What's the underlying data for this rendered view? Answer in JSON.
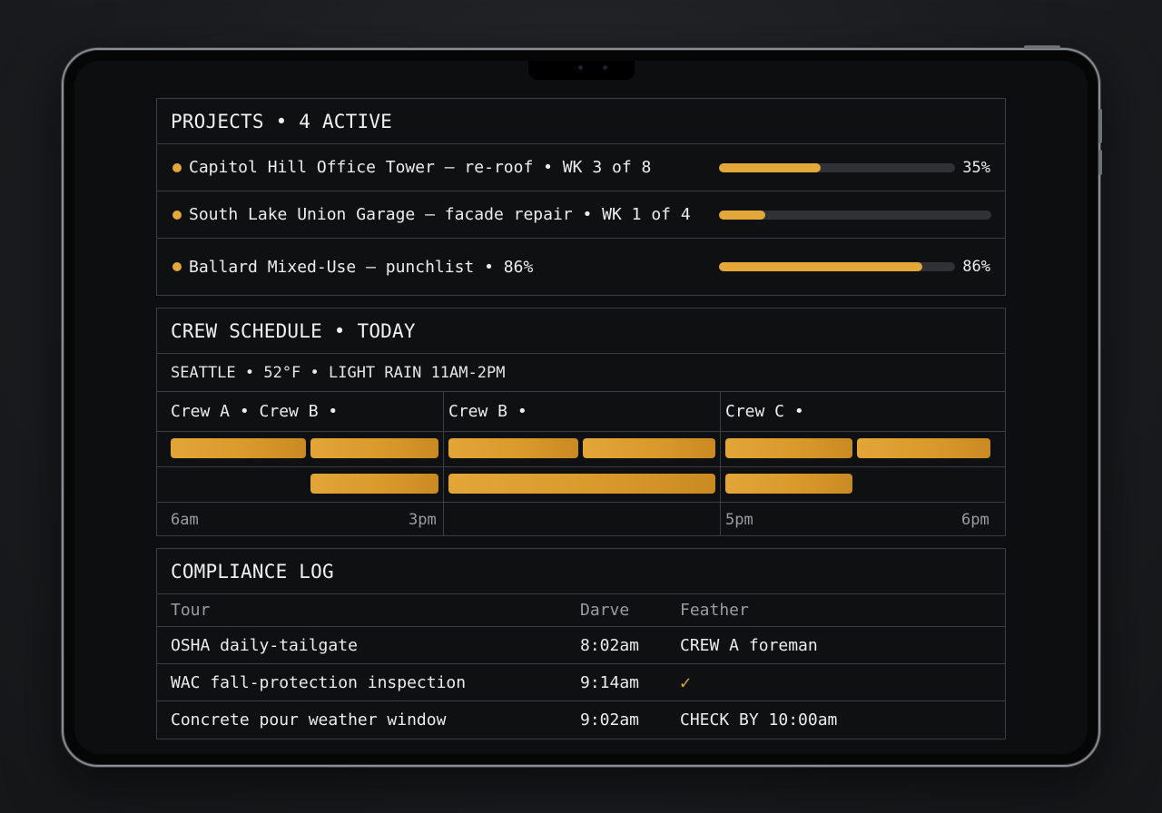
{
  "projects": {
    "title": "PROJECTS • 4 ACTIVE",
    "items": [
      {
        "label": "Capitol Hill Office Tower — re-roof • WK 3 of 8",
        "progress": 0.43,
        "pct_label": "35%"
      },
      {
        "label": "South Lake Union Garage — facade repair • WK 1 of 4",
        "progress": 0.17,
        "pct_label": ""
      },
      {
        "label": "Ballard Mixed-Use — punchlist • 86%",
        "progress": 0.86,
        "pct_label": "86%"
      }
    ],
    "accent": "#e3a73a"
  },
  "crew": {
    "title": "CREW SCHEDULE • TODAY",
    "weather": "SEATTLE • 52°F • LIGHT RAIN 11AM-2PM",
    "columns": [
      "Crew A • Crew B •",
      "Crew B •",
      "Crew C •"
    ],
    "ticks": [
      "6am",
      "3pm",
      "5pm",
      "6pm"
    ]
  },
  "compliance": {
    "title": "COMPLIANCE LOG",
    "headers": [
      "Tour",
      "Darve",
      "Feather"
    ],
    "rows": [
      {
        "tour": "OSHA daily-tailgate",
        "time": "8:02am",
        "status": "CREW A foreman"
      },
      {
        "tour": "WAC fall-protection inspection",
        "time": "9:14am",
        "status": "✓"
      },
      {
        "tour": "Concrete pour weather window",
        "time": "9:02am",
        "status": "CHECK BY 10:00am"
      }
    ]
  }
}
